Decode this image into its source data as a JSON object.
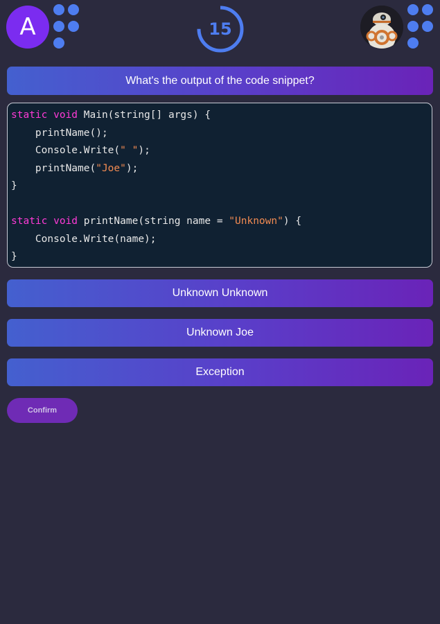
{
  "player": {
    "initial": "A"
  },
  "timer": {
    "value": "15",
    "progress": 0.75,
    "color": "#4e7df0"
  },
  "opponent": {
    "avatar_icon": "bb8-robot-avatar"
  },
  "question": {
    "text": "What's the output of the code snippet?"
  },
  "code": {
    "lines": [
      [
        {
          "t": "static void",
          "c": "kw"
        },
        {
          "t": " Main(string[] args) {",
          "c": ""
        }
      ],
      [
        {
          "t": "    printName();",
          "c": ""
        }
      ],
      [
        {
          "t": "    Console.Write(",
          "c": ""
        },
        {
          "t": "\" \"",
          "c": "str"
        },
        {
          "t": ");",
          "c": ""
        }
      ],
      [
        {
          "t": "    printName(",
          "c": ""
        },
        {
          "t": "\"Joe\"",
          "c": "str"
        },
        {
          "t": ");",
          "c": ""
        }
      ],
      [
        {
          "t": "}",
          "c": ""
        }
      ],
      [],
      [
        {
          "t": "static void",
          "c": "kw"
        },
        {
          "t": " printName(string name = ",
          "c": ""
        },
        {
          "t": "\"Unknown\"",
          "c": "str"
        },
        {
          "t": ") {",
          "c": ""
        }
      ],
      [
        {
          "t": "    Console.Write(name);",
          "c": ""
        }
      ],
      [
        {
          "t": "}",
          "c": ""
        }
      ]
    ]
  },
  "answers": [
    {
      "label": "Unknown Unknown"
    },
    {
      "label": "Unknown Joe"
    },
    {
      "label": "Exception"
    }
  ],
  "confirm": {
    "label": "Confirm"
  },
  "colors": {
    "background": "#2b2a3e",
    "accent": "#4e7df0",
    "purple": "#7b2cf0"
  }
}
